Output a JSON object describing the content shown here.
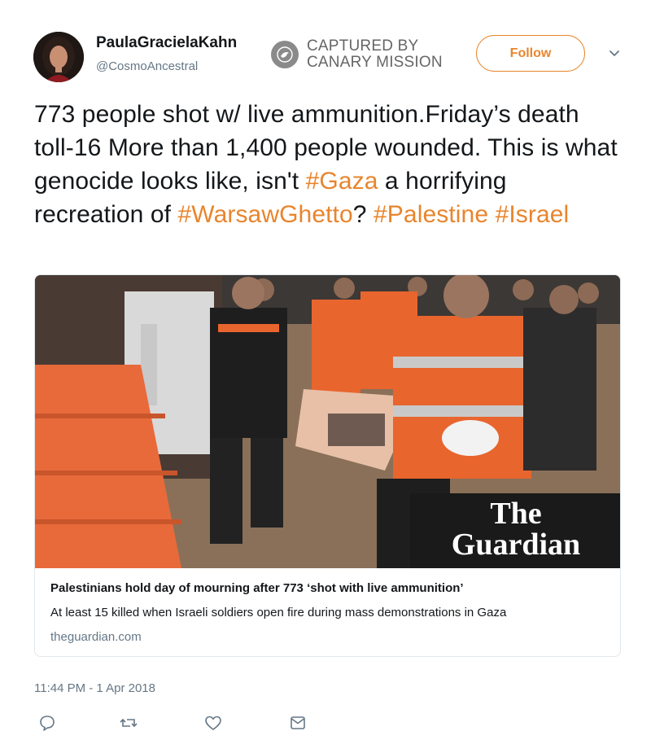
{
  "user": {
    "display_name": "PaulaGracielaKahn",
    "handle": "@CosmoAncestral"
  },
  "stamp": {
    "line1": "CAPTURED BY",
    "line2": "CANARY MISSION",
    "icon": "canary-bird-icon"
  },
  "follow_label": "Follow",
  "tweet": {
    "segments": [
      {
        "text": "773 people shot w/ live ammunition.Friday’s death toll-16 More than 1,400 people wounded. This is what genocide looks like, isn't ",
        "tag": false
      },
      {
        "text": "#Gaza",
        "tag": true
      },
      {
        "text": " a horrifying recreation of ",
        "tag": false
      },
      {
        "text": "#WarsawGhetto",
        "tag": true
      },
      {
        "text": "? ",
        "tag": false
      },
      {
        "text": "#Palestine",
        "tag": true
      },
      {
        "text": " ",
        "tag": false
      },
      {
        "text": "#Israel",
        "tag": true
      }
    ]
  },
  "card": {
    "image_watermark_line1": "The",
    "image_watermark_line2": "Guardian",
    "title": "Palestinians hold day of mourning after 773 ‘shot with live ammunition’",
    "description": "At least 15 killed when Israeli soldiers open fire during mass demonstrations in Gaza",
    "domain": "theguardian.com"
  },
  "timestamp": "11:44 PM - 1 Apr 2018",
  "actions": [
    "reply-icon",
    "retweet-icon",
    "like-icon",
    "direct-message-icon"
  ],
  "colors": {
    "accent": "#e8852d",
    "text": "#14171a",
    "muted": "#657786",
    "border": "#e1e8ed"
  }
}
